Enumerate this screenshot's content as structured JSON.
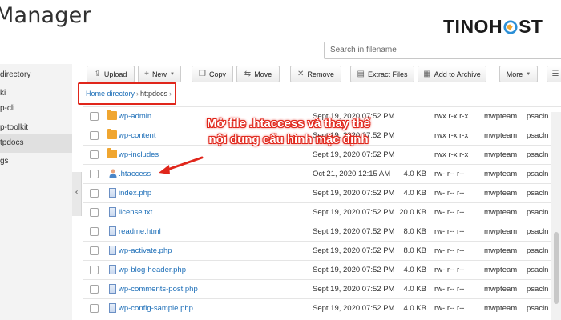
{
  "header": {
    "title": "Manager"
  },
  "logo": {
    "part1": "TINO",
    "part2a": "H",
    "part2b": "ST"
  },
  "search": {
    "placeholder": "Search in filename"
  },
  "sidebar": {
    "items": [
      {
        "label": "directory"
      },
      {
        "label": "ki"
      },
      {
        "label": "p-cli"
      },
      {
        "label": "p-toolkit"
      },
      {
        "label": "tpdocs"
      },
      {
        "label": "gs"
      }
    ]
  },
  "toolbar": {
    "upload": "Upload",
    "new": "New",
    "copy": "Copy",
    "move": "Move",
    "remove": "Remove",
    "extract": "Extract Files",
    "archive": "Add to Archive",
    "more": "More"
  },
  "breadcrumb": {
    "home": "Home directory",
    "current": "httpdocs"
  },
  "annotation": {
    "line1": "Mở file .htaccess và thay thế",
    "line2": "nội dung cấu hình mặc định"
  },
  "files": [
    {
      "name": "wp-admin",
      "type": "folder",
      "date": "Sept 19, 2020 07:52 PM",
      "size": "",
      "perm": "rwx r-x r-x",
      "owner": "mwpteam",
      "group": "psacln"
    },
    {
      "name": "wp-content",
      "type": "folder",
      "date": "Sept 19, 2020 07:52 PM",
      "size": "",
      "perm": "rwx r-x r-x",
      "owner": "mwpteam",
      "group": "psacln"
    },
    {
      "name": "wp-includes",
      "type": "folder",
      "date": "Sept 19, 2020 07:52 PM",
      "size": "",
      "perm": "rwx r-x r-x",
      "owner": "mwpteam",
      "group": "psacln"
    },
    {
      "name": ".htaccess",
      "type": "user",
      "date": "Oct 21, 2020 12:15 AM",
      "size": "4.0 KB",
      "perm": "rw- r-- r--",
      "owner": "mwpteam",
      "group": "psacln"
    },
    {
      "name": "index.php",
      "type": "file",
      "date": "Sept 19, 2020 07:52 PM",
      "size": "4.0 KB",
      "perm": "rw- r-- r--",
      "owner": "mwpteam",
      "group": "psacln"
    },
    {
      "name": "license.txt",
      "type": "file",
      "date": "Sept 19, 2020 07:52 PM",
      "size": "20.0 KB",
      "perm": "rw- r-- r--",
      "owner": "mwpteam",
      "group": "psacln"
    },
    {
      "name": "readme.html",
      "type": "file",
      "date": "Sept 19, 2020 07:52 PM",
      "size": "8.0 KB",
      "perm": "rw- r-- r--",
      "owner": "mwpteam",
      "group": "psacln"
    },
    {
      "name": "wp-activate.php",
      "type": "file",
      "date": "Sept 19, 2020 07:52 PM",
      "size": "8.0 KB",
      "perm": "rw- r-- r--",
      "owner": "mwpteam",
      "group": "psacln"
    },
    {
      "name": "wp-blog-header.php",
      "type": "file",
      "date": "Sept 19, 2020 07:52 PM",
      "size": "4.0 KB",
      "perm": "rw- r-- r--",
      "owner": "mwpteam",
      "group": "psacln"
    },
    {
      "name": "wp-comments-post.php",
      "type": "file",
      "date": "Sept 19, 2020 07:52 PM",
      "size": "4.0 KB",
      "perm": "rw- r-- r--",
      "owner": "mwpteam",
      "group": "psacln"
    },
    {
      "name": "wp-config-sample.php",
      "type": "file",
      "date": "Sept 19, 2020 07:52 PM",
      "size": "4.0 KB",
      "perm": "rw- r-- r--",
      "owner": "mwpteam",
      "group": "psacln"
    }
  ],
  "colors": {
    "accent_red": "#e0261b",
    "link_blue": "#1e6fb8",
    "folder": "#f0a630"
  }
}
